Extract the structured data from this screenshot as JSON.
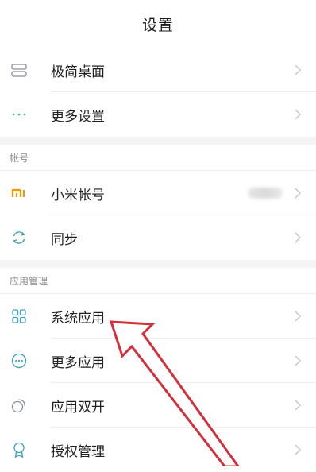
{
  "header": {
    "title": "设置"
  },
  "rows": [
    {
      "label": "极简桌面",
      "icon": "minimal-desktop-icon"
    },
    {
      "label": "更多设置",
      "icon": "more-settings-icon"
    }
  ],
  "account": {
    "section_title": "帐号",
    "items": [
      {
        "label": "小米帐号",
        "icon": "mi-logo-icon",
        "accent": "#f39800"
      },
      {
        "label": "同步",
        "icon": "sync-icon"
      }
    ]
  },
  "apps": {
    "section_title": "应用管理",
    "items": [
      {
        "label": "系统应用",
        "icon": "grid-apps-icon"
      },
      {
        "label": "更多应用",
        "icon": "more-apps-icon"
      },
      {
        "label": "应用双开",
        "icon": "dual-apps-icon"
      },
      {
        "label": "授权管理",
        "icon": "permissions-icon"
      }
    ]
  },
  "annotation": {
    "color": "#d32f3a",
    "icon": "red-pointer-arrow"
  },
  "icon_color": "#3aa3b8",
  "chevron_color": "#c4c4c4"
}
